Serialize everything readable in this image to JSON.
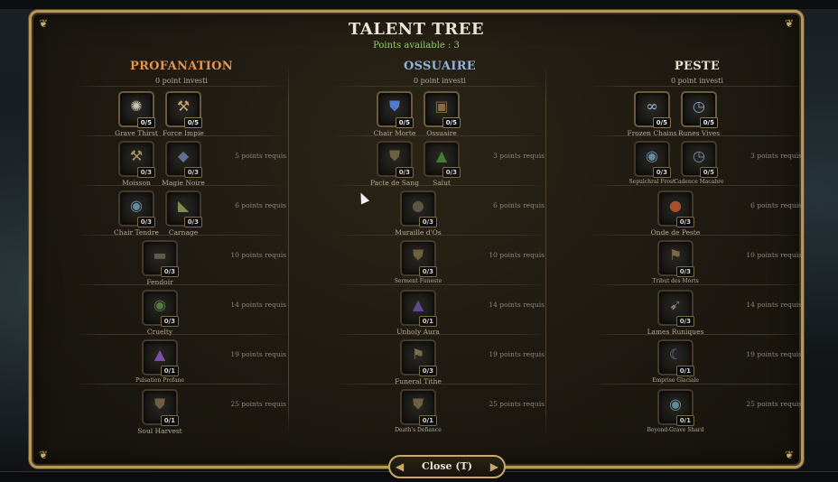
{
  "window": {
    "title": "TALENT TREE",
    "points_available": "Points available : 3",
    "close_label": "Close  (T)"
  },
  "colors": {
    "profanation": "#e3944e",
    "ossuaire": "#8fb3d9",
    "peste": "#e8e2d2",
    "points": "#8fcf63",
    "frame": "#b8975a"
  },
  "trees": [
    {
      "name": "PROFANATION",
      "invested": "0 point investi",
      "requirements": [
        "5 points requis",
        "6 points requis",
        "10 points requis",
        "14 points requis",
        "19 points requis",
        "25 points requis"
      ],
      "talents": [
        {
          "name": "Grave Thirst",
          "rank": "0/5",
          "icon": "splatter-icon"
        },
        {
          "name": "Force Impie",
          "rank": "0/5",
          "icon": "hammer-icon"
        },
        {
          "name": "Moisson",
          "rank": "0/3",
          "icon": "hammer-icon"
        },
        {
          "name": "Magie Noire",
          "rank": "0/3",
          "icon": "crystal-icon"
        },
        {
          "name": "Chair Tendre",
          "rank": "0/3",
          "icon": "orb-icon"
        },
        {
          "name": "Carnage",
          "rank": "0/3",
          "icon": "blade-icon"
        },
        {
          "name": "Fendoir",
          "rank": "0/3",
          "icon": "cleaver-icon"
        },
        {
          "name": "Cruelty",
          "rank": "0/3",
          "icon": "eye-icon"
        },
        {
          "name": "Pulsation Profane",
          "rank": "0/1",
          "icon": "flask-icon"
        },
        {
          "name": "Soul Harvest",
          "rank": "0/1",
          "icon": "shield-icon"
        }
      ]
    },
    {
      "name": "OSSUAIRE",
      "invested": "0 point investi",
      "requirements": [
        "3 points requis",
        "6 points requis",
        "10 points requis",
        "14 points requis",
        "19 points requis",
        "25 points requis"
      ],
      "talents": [
        {
          "name": "Chair Morte",
          "rank": "0/5",
          "icon": "shield-cross-icon"
        },
        {
          "name": "Ossuaire",
          "rank": "0/5",
          "icon": "chest-icon"
        },
        {
          "name": "Pacte de Sang",
          "rank": "0/3",
          "icon": "shield-icon"
        },
        {
          "name": "Salut",
          "rank": "0/3",
          "icon": "arrow-up-icon"
        },
        {
          "name": "Muraille d'Os",
          "rank": "0/3",
          "icon": "bone-icon"
        },
        {
          "name": "Serment Funeste",
          "rank": "0/3",
          "icon": "shield-icon"
        },
        {
          "name": "Unholy Aura",
          "rank": "0/1",
          "icon": "aura-icon"
        },
        {
          "name": "Funeral Tithe",
          "rank": "0/3",
          "icon": "flag-icon"
        },
        {
          "name": "Death's Defiance",
          "rank": "0/1",
          "icon": "shield-icon"
        }
      ]
    },
    {
      "name": "PESTE",
      "invested": "0 point investi",
      "requirements": [
        "3 points requis",
        "6 points requis",
        "10 points requis",
        "14 points requis",
        "19 points requis",
        "25 points requis"
      ],
      "talents": [
        {
          "name": "Frozen Chains",
          "rank": "0/5",
          "icon": "chain-icon"
        },
        {
          "name": "Runes Vives",
          "rank": "0/5",
          "icon": "clock-icon"
        },
        {
          "name": "Sepulchral Frost",
          "rank": "0/3",
          "icon": "orb-icon"
        },
        {
          "name": "Cadence Macabre",
          "rank": "0/5",
          "icon": "clock-icon"
        },
        {
          "name": "Onde de Peste",
          "rank": "0/3",
          "icon": "mace-icon"
        },
        {
          "name": "Tribut des Morts",
          "rank": "0/3",
          "icon": "flag-icon"
        },
        {
          "name": "Lames Runiques",
          "rank": "0/3",
          "icon": "sword-icon"
        },
        {
          "name": "Emprise Glaciale",
          "rank": "0/1",
          "icon": "crescent-icon"
        },
        {
          "name": "Beyond-Grave Shard",
          "rank": "0/1",
          "icon": "orb-icon"
        }
      ]
    }
  ]
}
